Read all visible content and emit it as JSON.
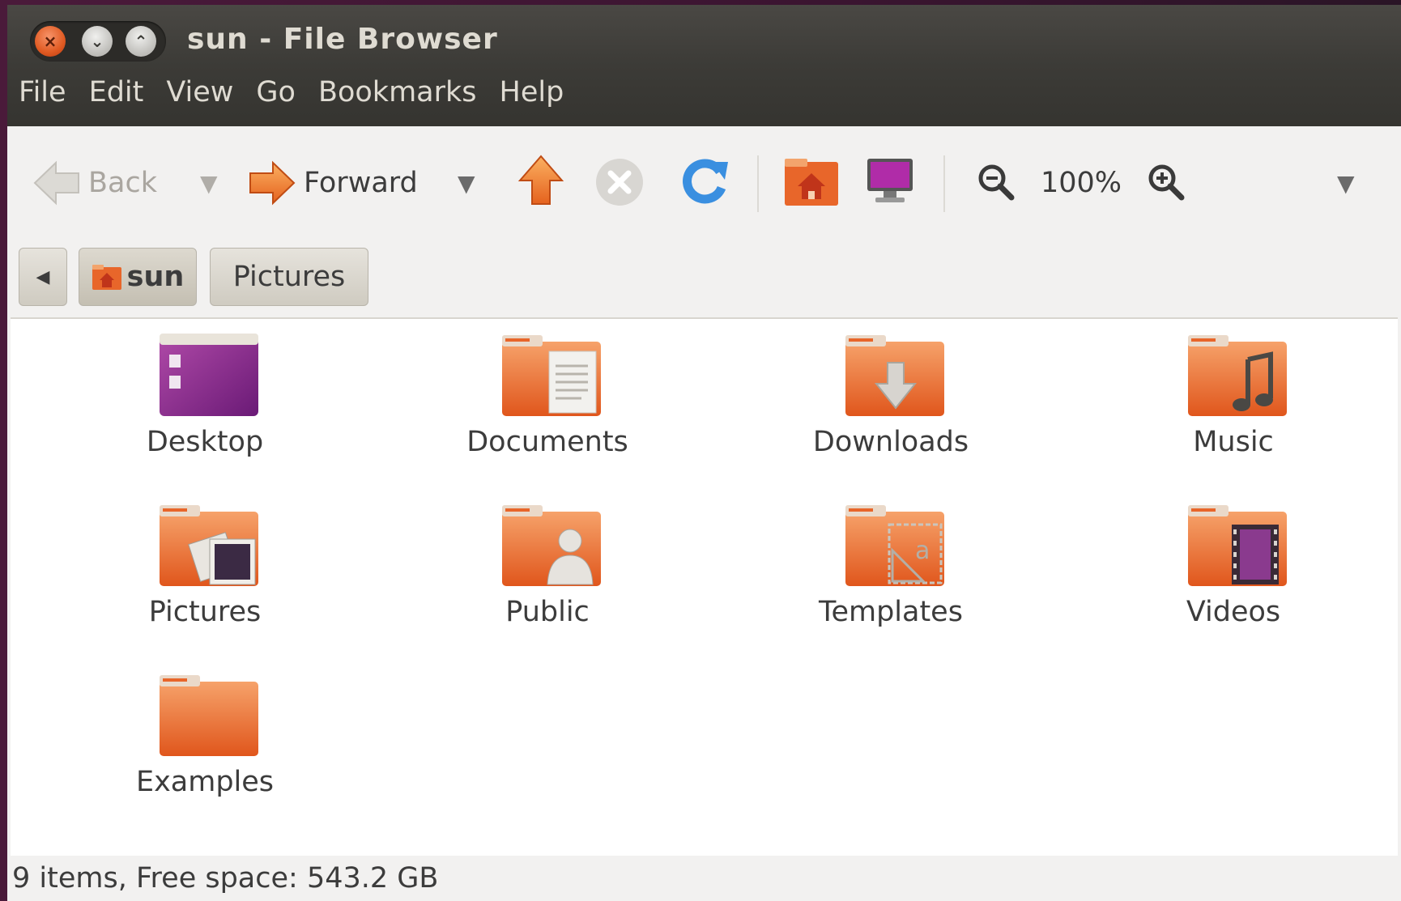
{
  "window": {
    "title": "sun - File Browser"
  },
  "wm_buttons": {
    "close": "×",
    "minimize": "⌄",
    "maximize": "⌃"
  },
  "menu": [
    "File",
    "Edit",
    "View",
    "Go",
    "Bookmarks",
    "Help"
  ],
  "toolbar": {
    "back_label": "Back",
    "forward_label": "Forward",
    "zoom_level": "100%",
    "dropdown_glyph": "▼"
  },
  "pathbar": {
    "scroll_left_glyph": "◀",
    "crumbs": [
      "sun",
      "Pictures"
    ]
  },
  "files": [
    "Desktop",
    "Documents",
    "Downloads",
    "Music",
    "Pictures",
    "Public",
    "Templates",
    "Videos",
    "Examples"
  ],
  "status": "9 items, Free space: 543.2 GB",
  "colors": {
    "accent_orange": "#e8662a",
    "desktop_purple": "#8a2a8e",
    "titlebar": "#3c3b37",
    "content_bg": "#ffffff"
  }
}
